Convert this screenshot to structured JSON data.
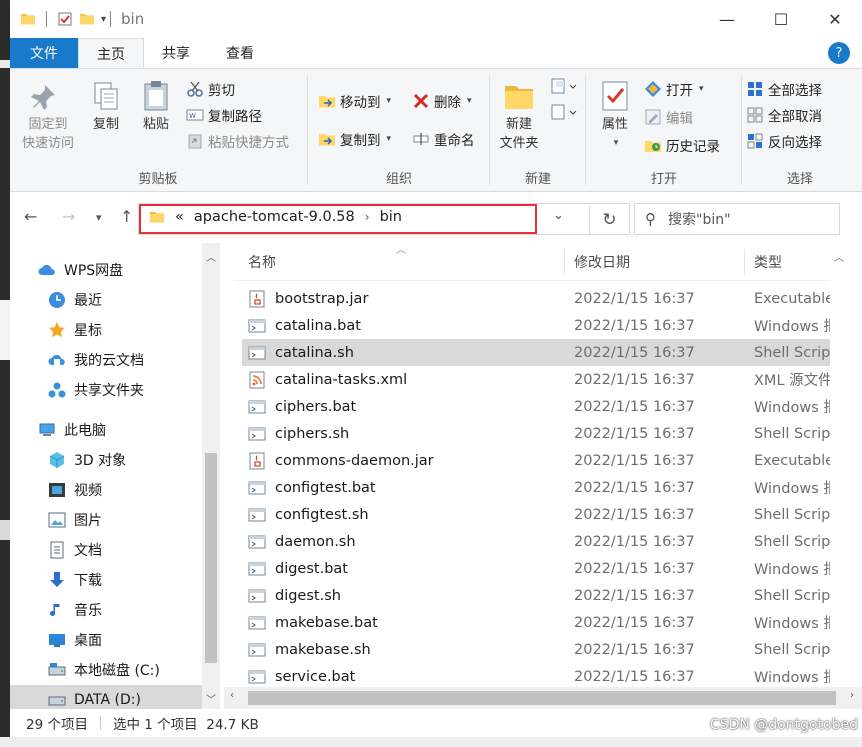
{
  "window": {
    "title": "bin",
    "controls": {
      "minimize": "—",
      "maximize": "☐",
      "close": "✕"
    }
  },
  "tabs": {
    "file": "文件",
    "home": "主页",
    "share": "共享",
    "view": "查看",
    "help": "?"
  },
  "ribbon": {
    "clipboard": {
      "name": "剪贴板",
      "pin_line1": "固定到",
      "pin_line2": "快速访问",
      "copy": "复制",
      "paste": "粘贴",
      "cut": "剪切",
      "copy_path": "复制路径",
      "paste_shortcut": "粘贴快捷方式"
    },
    "organize": {
      "name": "组织",
      "move_to": "移动到",
      "copy_to": "复制到",
      "delete": "删除",
      "rename": "重命名"
    },
    "new": {
      "name": "新建",
      "new_folder_line1": "新建",
      "new_folder_line2": "文件夹"
    },
    "open": {
      "name": "打开",
      "properties": "属性",
      "open": "打开",
      "edit": "编辑",
      "history": "历史记录"
    },
    "select": {
      "name": "选择",
      "select_all": "全部选择",
      "select_none": "全部取消",
      "invert": "反向选择"
    }
  },
  "address": {
    "overflow": "«",
    "crumbs": [
      "apache-tomcat-9.0.58",
      "bin"
    ],
    "search_placeholder": "搜索\"bin\""
  },
  "nav": {
    "items": [
      {
        "label": "WPS网盘",
        "icon": "cloud-icon"
      },
      {
        "label": "最近",
        "icon": "clock-icon"
      },
      {
        "label": "星标",
        "icon": "star-icon"
      },
      {
        "label": "我的云文档",
        "icon": "cloud-doc-icon"
      },
      {
        "label": "共享文件夹",
        "icon": "share-folder-icon"
      },
      {
        "label": "此电脑",
        "icon": "computer-icon"
      },
      {
        "label": "3D 对象",
        "icon": "cube-icon"
      },
      {
        "label": "视频",
        "icon": "video-icon"
      },
      {
        "label": "图片",
        "icon": "picture-icon"
      },
      {
        "label": "文档",
        "icon": "document-icon"
      },
      {
        "label": "下载",
        "icon": "download-icon"
      },
      {
        "label": "音乐",
        "icon": "music-icon"
      },
      {
        "label": "桌面",
        "icon": "desktop-icon"
      },
      {
        "label": "本地磁盘 (C:)",
        "icon": "drive-icon"
      },
      {
        "label": "DATA (D:)",
        "icon": "drive-icon"
      }
    ]
  },
  "columns": {
    "name": "名称",
    "date": "修改日期",
    "type": "类型"
  },
  "files": [
    {
      "name": "bootstrap.jar",
      "date": "2022/1/15 16:37",
      "type": "Executable",
      "icon": "jar-icon"
    },
    {
      "name": "catalina.bat",
      "date": "2022/1/15 16:37",
      "type": "Windows 批",
      "icon": "bat-icon"
    },
    {
      "name": "catalina.sh",
      "date": "2022/1/15 16:37",
      "type": "Shell Script",
      "icon": "sh-icon",
      "selected": true
    },
    {
      "name": "catalina-tasks.xml",
      "date": "2022/1/15 16:37",
      "type": "XML 源文件",
      "icon": "xml-icon"
    },
    {
      "name": "ciphers.bat",
      "date": "2022/1/15 16:37",
      "type": "Windows 批",
      "icon": "bat-icon"
    },
    {
      "name": "ciphers.sh",
      "date": "2022/1/15 16:37",
      "type": "Shell Script",
      "icon": "sh-icon"
    },
    {
      "name": "commons-daemon.jar",
      "date": "2022/1/15 16:37",
      "type": "Executable",
      "icon": "jar-icon"
    },
    {
      "name": "configtest.bat",
      "date": "2022/1/15 16:37",
      "type": "Windows 批",
      "icon": "bat-icon"
    },
    {
      "name": "configtest.sh",
      "date": "2022/1/15 16:37",
      "type": "Shell Script",
      "icon": "sh-icon"
    },
    {
      "name": "daemon.sh",
      "date": "2022/1/15 16:37",
      "type": "Shell Script",
      "icon": "sh-icon"
    },
    {
      "name": "digest.bat",
      "date": "2022/1/15 16:37",
      "type": "Windows 批",
      "icon": "bat-icon"
    },
    {
      "name": "digest.sh",
      "date": "2022/1/15 16:37",
      "type": "Shell Script",
      "icon": "sh-icon"
    },
    {
      "name": "makebase.bat",
      "date": "2022/1/15 16:37",
      "type": "Windows 批",
      "icon": "bat-icon"
    },
    {
      "name": "makebase.sh",
      "date": "2022/1/15 16:37",
      "type": "Shell Script",
      "icon": "sh-icon"
    },
    {
      "name": "service.bat",
      "date": "2022/1/15 16:37",
      "type": "Windows 批",
      "icon": "bat-icon"
    }
  ],
  "status": {
    "count": "29 个项目",
    "selection": "选中 1 个项目  24.7 KB"
  },
  "watermark": "CSDN @dontgotobed"
}
